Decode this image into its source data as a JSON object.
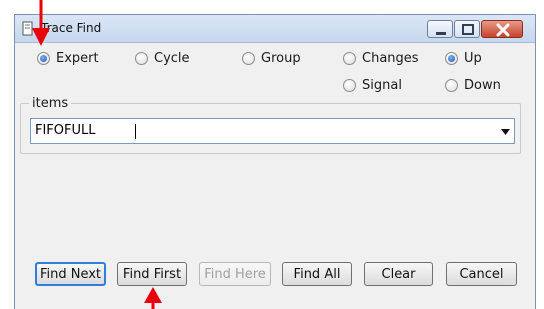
{
  "window": {
    "title": "Trace Find",
    "controls": [
      "minimize",
      "maximize",
      "close"
    ]
  },
  "radios": {
    "mode": [
      {
        "label": "Expert",
        "checked": true
      },
      {
        "label": "Cycle",
        "checked": false
      },
      {
        "label": "Group",
        "checked": false
      },
      {
        "label": "Changes",
        "checked": false
      },
      {
        "label": "Signal",
        "checked": false
      }
    ],
    "direction": [
      {
        "label": "Up",
        "checked": true
      },
      {
        "label": "Down",
        "checked": false
      }
    ]
  },
  "items": {
    "group_label": "items",
    "value": "FIFOFULL"
  },
  "buttons": {
    "find_next": "Find Next",
    "find_first": "Find First",
    "find_here": "Find Here",
    "find_all": "Find All",
    "clear": "Clear",
    "cancel": "Cancel"
  },
  "colors": {
    "annotation": "#e8000b",
    "accent": "#2f7fd7"
  }
}
